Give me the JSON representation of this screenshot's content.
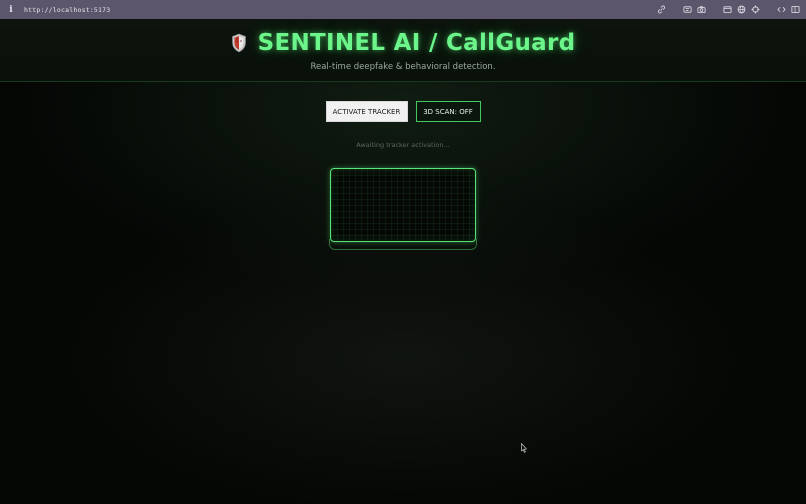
{
  "browser": {
    "url": "http://localhost:5173",
    "info_icon": "i",
    "toolbar_icons": [
      "link-icon",
      "reader-icon",
      "camera-icon",
      "window-icon",
      "globe-icon",
      "crosshair-icon",
      "code-icon",
      "sidebar-icon"
    ]
  },
  "header": {
    "logo_icon": "shield-icon",
    "title": "SENTINEL AI / CallGuard",
    "subtitle": "Real-time deepfake & behavioral detection."
  },
  "controls": {
    "activate_label": "ACTIVATE TRACKER",
    "scan_label": "3D SCAN: OFF"
  },
  "status_text": "Awaiting tracker activation...",
  "colors": {
    "accent": "#6cf58a",
    "border_green": "#59e276",
    "background": "#050705",
    "browser_bar": "#5b566b"
  }
}
